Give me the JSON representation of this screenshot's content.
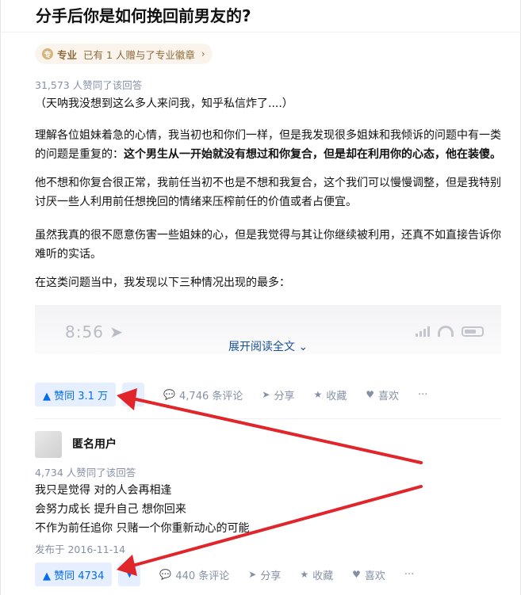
{
  "question": {
    "title": "分手后你是如何挽回前男友的?"
  },
  "badge": {
    "icon": "专",
    "label": "专业",
    "text": "已有 1 人赠与了专业徽章",
    "chevron": "›"
  },
  "answer1": {
    "votes_line": "31,573 人赞同了该回答",
    "p1": "（天呐我没想到这么多人来问我，知乎私信炸了....）",
    "p2_a": "理解各位姐妹着急的心情，我当初也和你们一样，但是我发现很多姐妹和我倾诉的问题中有一类的问题是重复的：",
    "p2_b": "这个男生从一开始就没有想过和你复合，但是却在利用你的心态，他在装傻。",
    "p3": "他不想和你复合很正常，我前任当初不也是不想和我复合，这个我们可以慢慢调整，但是我特别讨厌一些人利用前任想挽回的情绪来压榨前任的价值或者占便宜。",
    "p4": "虽然我真的很不愿意伤害一些姐妹的心，但是我觉得与其让你继续被利用，还真不如直接告诉你难听的实话。",
    "p5": "在这类问题当中，我发现以下三种情况出现的最多：",
    "preview_time": "8:56 ➤",
    "expand_label": "展开阅读全文 ⌄",
    "actions": {
      "vote_up": "▲ 赞同 3.1 万",
      "vote_down": "▼",
      "comments": "4,746 条评论",
      "share": "分享",
      "favorite": "收藏",
      "like": "喜欢",
      "more": "···"
    }
  },
  "answer2": {
    "author": "匿名用户",
    "votes_line": "4,734 人赞同了该回答",
    "lines": [
      "我只是觉得 对的人会再相逢",
      "会努力成长 提升自己 想你回来",
      "不作为前任追你 只赌一个你重新动心的可能"
    ],
    "published": "发布于 2016-11-14",
    "actions": {
      "vote_up": "▲ 赞同 4734",
      "vote_down": "▼",
      "comments": "440 条评论",
      "share": "分享",
      "favorite": "收藏",
      "like": "喜欢",
      "more": "···"
    }
  },
  "icons": {
    "comment": "💬",
    "share": "➤",
    "favorite": "★",
    "like": "♥"
  },
  "colors": {
    "accent": "#056de8",
    "link": "#175199",
    "arrow": "#e0252b",
    "muted": "#8590a6"
  }
}
